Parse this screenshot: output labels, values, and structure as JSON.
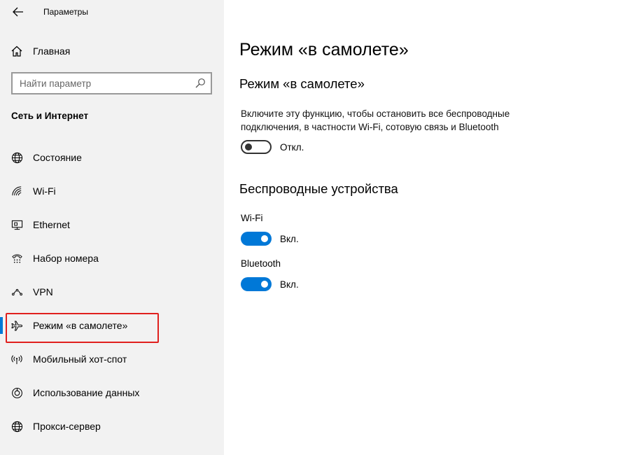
{
  "window": {
    "title": "Параметры"
  },
  "sidebar": {
    "home_label": "Главная",
    "search_placeholder": "Найти параметр",
    "section_title": "Сеть и Интернет",
    "items": [
      {
        "label": "Состояние",
        "icon": "globe-icon"
      },
      {
        "label": "Wi-Fi",
        "icon": "wifi-icon"
      },
      {
        "label": "Ethernet",
        "icon": "ethernet-icon"
      },
      {
        "label": "Набор номера",
        "icon": "dialup-icon"
      },
      {
        "label": "VPN",
        "icon": "vpn-icon"
      },
      {
        "label": "Режим «в самолете»",
        "icon": "airplane-icon",
        "active": true,
        "highlighted": true
      },
      {
        "label": "Мобильный хот-спот",
        "icon": "hotspot-icon"
      },
      {
        "label": "Использование данных",
        "icon": "data-usage-icon"
      },
      {
        "label": "Прокси-сервер",
        "icon": "globe-icon"
      }
    ]
  },
  "main": {
    "page_title": "Режим «в самолете»",
    "airplane_section": {
      "title": "Режим «в самолете»",
      "description": "Включите эту функцию, чтобы остановить все беспроводные подключения, в частности Wi-Fi, сотовую связь и Bluetooth",
      "toggle_state": "Откл.",
      "toggle_on": false
    },
    "wireless_section": {
      "title": "Беспроводные устройства",
      "devices": [
        {
          "label": "Wi-Fi",
          "state": "Вкл.",
          "on": true
        },
        {
          "label": "Bluetooth",
          "state": "Вкл.",
          "on": true
        }
      ]
    }
  },
  "colors": {
    "accent": "#0078d7",
    "highlight": "#e0201e",
    "sidebar_bg": "#f2f2f2"
  }
}
